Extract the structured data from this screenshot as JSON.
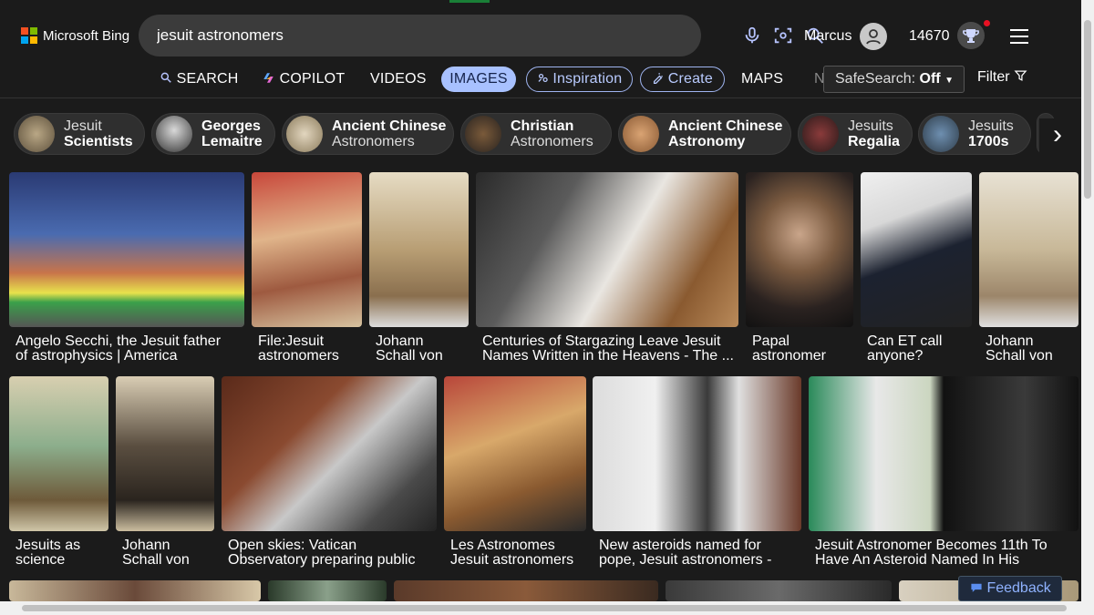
{
  "app": {
    "logo_text": "Microsoft Bing"
  },
  "search": {
    "query": "jesuit astronomers"
  },
  "user": {
    "name": "Marcus",
    "points": "14670"
  },
  "nav": {
    "search": "SEARCH",
    "copilot": "COPILOT",
    "videos": "VIDEOS",
    "images": "IMAGES",
    "inspiration": "Inspiration",
    "create": "Create",
    "maps": "MAPS",
    "more": "N"
  },
  "safesearch": {
    "label": "SafeSearch:",
    "value": "Off"
  },
  "filter": {
    "label": "Filter"
  },
  "chips": [
    {
      "line1": "Jesuit",
      "line2": "Scientists"
    },
    {
      "line1": "Georges",
      "line2": "Lemaitre"
    },
    {
      "line1": "Ancient Chinese",
      "line2": "Astronomers"
    },
    {
      "line1": "Christian",
      "line2": "Astronomers"
    },
    {
      "line1": "Ancient Chinese",
      "line2": "Astronomy"
    },
    {
      "line1": "Jesuits",
      "line2": "Regalia"
    },
    {
      "line1": "Jesuits",
      "line2": "1700s"
    }
  ],
  "results": [
    {
      "line1": "Angelo Secchi, the Jesuit father",
      "line2": "of astrophysics | America"
    },
    {
      "line1": "File:Jesuit",
      "line2": "astronomers"
    },
    {
      "line1": "Johann",
      "line2": "Schall von"
    },
    {
      "line1": "Centuries of Stargazing Leave Jesuit",
      "line2": "Names Written in the Heavens - The ..."
    },
    {
      "line1": "Papal",
      "line2": "astronomer"
    },
    {
      "line1": "Can ET call",
      "line2": "anyone?"
    },
    {
      "line1": "Johann",
      "line2": "Schall von"
    },
    {
      "line1": "Jesuits as",
      "line2": "science"
    },
    {
      "line1": "Johann",
      "line2": "Schall von"
    },
    {
      "line1": "Open skies: Vatican",
      "line2": "Observatory preparing public"
    },
    {
      "line1": "Les Astronomes",
      "line2": "Jesuit astronomers"
    },
    {
      "line1": "New asteroids named for",
      "line2": "pope, Jesuit astronomers -"
    },
    {
      "line1": "Jesuit Astronomer Becomes 11th To",
      "line2": "Have An Asteroid Named In His"
    }
  ],
  "feedback": {
    "label": "Feedback"
  },
  "colors": {
    "accent": "#a8c1ff",
    "background": "#1b1b1b",
    "outline": "#9fb4f0"
  }
}
